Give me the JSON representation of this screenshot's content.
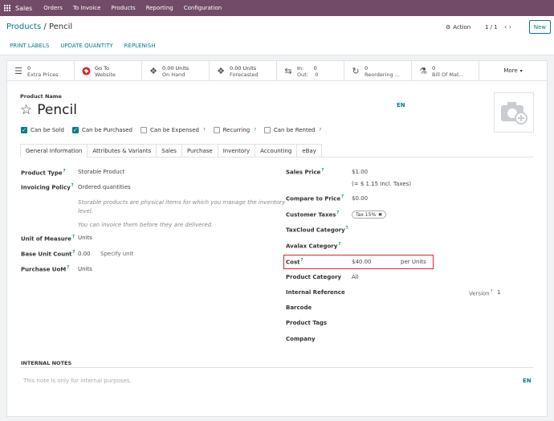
{
  "topbar": {
    "app_name": "Sales",
    "menu": [
      "Orders",
      "To Invoice",
      "Products",
      "Reporting",
      "Configuration"
    ]
  },
  "control_panel": {
    "breadcrumb_parent": "Products",
    "breadcrumb_sep": "/",
    "breadcrumb_current": "Pencil",
    "action_label": "Action",
    "pager": "1 / 1",
    "new_label": "New",
    "buttons": [
      "PRINT LABELS",
      "UPDATE QUANTITY",
      "REPLENISH"
    ]
  },
  "smart_buttons": [
    {
      "icon": "list-icon",
      "value": "0",
      "label": "Extra Prices"
    },
    {
      "icon": "globe-icon",
      "value": "Go To",
      "label": "Website"
    },
    {
      "icon": "cubes-icon",
      "value": "0.00 Units",
      "label": "On Hand"
    },
    {
      "icon": "cubes-icon",
      "value": "0.00 Units",
      "label": "Forecasted"
    },
    {
      "icon": "exchange-icon",
      "value": "In:      0",
      "label": "Out:    0"
    },
    {
      "icon": "refresh-icon",
      "value": "0",
      "label": "Reordering ..."
    },
    {
      "icon": "flask-icon",
      "value": "0",
      "label": "Bill Of Mat..."
    }
  ],
  "more_label": "More",
  "product": {
    "name_label": "Product Name",
    "name": "Pencil",
    "lang": "EN"
  },
  "checkboxes": [
    {
      "label": "Can be Sold",
      "checked": true,
      "help": false
    },
    {
      "label": "Can be Purchased",
      "checked": true,
      "help": false
    },
    {
      "label": "Can be Expensed",
      "checked": false,
      "help": true
    },
    {
      "label": "Recurring",
      "checked": false,
      "help": true
    },
    {
      "label": "Can be Rented",
      "checked": false,
      "help": true
    }
  ],
  "tabs": [
    "General Information",
    "Attributes & Variants",
    "Sales",
    "Purchase",
    "Inventory",
    "Accounting",
    "eBay"
  ],
  "left_fields": {
    "product_type_label": "Product Type",
    "product_type": "Storable Product",
    "invoicing_policy_label": "Invoicing Policy",
    "invoicing_policy": "Ordered quantities",
    "policy_note1a": "Storable products are physical items for which you manage the inventory",
    "policy_note1b": "level.",
    "policy_note2": "You can invoice them before they are delivered.",
    "uom_label": "Unit of Measure",
    "uom": "Units",
    "base_unit_count_label": "Base Unit Count",
    "base_unit_count": "0.00",
    "base_unit_placeholder": "Specify unit",
    "purchase_uom_label": "Purchase UoM",
    "purchase_uom": "Units"
  },
  "right_fields": {
    "sales_price_label": "Sales Price",
    "sales_price": "$1.00",
    "incl_taxes": "(= $ 1.15 Incl. Taxes)",
    "compare_label": "Compare to Price",
    "compare": "$0.00",
    "customer_taxes_label": "Customer Taxes",
    "tax_tag": "Tax 15%",
    "taxcloud_label": "TaxCloud Category",
    "avalax_label": "Avalax Category",
    "cost_label": "Cost",
    "cost": "$40.00",
    "cost_unit": "per Units",
    "product_category_label": "Product Category",
    "product_category": "All",
    "internal_ref_label": "Internal Reference",
    "version_label": "Version",
    "version": "1",
    "barcode_label": "Barcode",
    "tags_label": "Product Tags",
    "company_label": "Company"
  },
  "notes": {
    "label": "INTERNAL NOTES",
    "placeholder": "This note is only for internal purposes.",
    "lang": "EN"
  },
  "colors": {
    "brand": "#714b67",
    "accent": "#017e84",
    "highlight": "#d9272e"
  }
}
